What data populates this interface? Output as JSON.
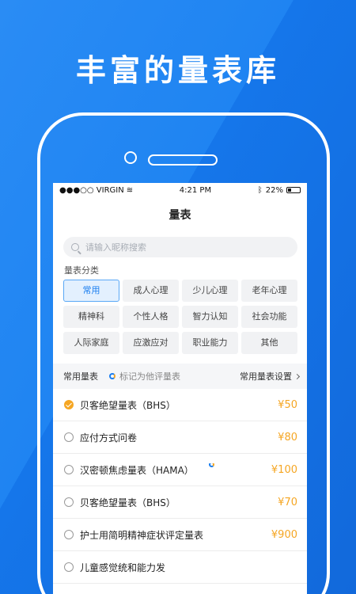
{
  "banner": {
    "headline": "丰富的量表库"
  },
  "statusbar": {
    "carrier": "●●●○○ VIRGIN",
    "time": "4:21 PM",
    "battery": "22%"
  },
  "nav": {
    "title": "量表"
  },
  "search": {
    "placeholder": "请输入昵称搜索"
  },
  "category": {
    "label": "量表分类",
    "items": [
      "常用",
      "成人心理",
      "少儿心理",
      "老年心理",
      "精神科",
      "个性人格",
      "智力认知",
      "社会功能",
      "人际家庭",
      "应激应对",
      "职业能力",
      "其他"
    ],
    "active_index": 0
  },
  "common": {
    "title": "常用量表",
    "note": "标记为他评量表",
    "settings": "常用量表设置"
  },
  "list": [
    {
      "name": "贝客绝望量表（BHS）",
      "price": "¥50",
      "checked": true,
      "marked": false
    },
    {
      "name": "应付方式问卷",
      "price": "¥80",
      "checked": false,
      "marked": false
    },
    {
      "name": "汉密顿焦虑量表（HAMA）",
      "price": "¥100",
      "checked": false,
      "marked": true
    },
    {
      "name": "贝客绝望量表（BHS）",
      "price": "¥70",
      "checked": false,
      "marked": false
    },
    {
      "name": "护士用简明精神症状评定量表",
      "price": "¥900",
      "checked": false,
      "marked": false
    },
    {
      "name": "儿童感觉统和能力发",
      "price": "",
      "checked": false,
      "marked": false
    }
  ],
  "colors": {
    "brand": "#1a7ef0",
    "price": "#f5a623"
  }
}
